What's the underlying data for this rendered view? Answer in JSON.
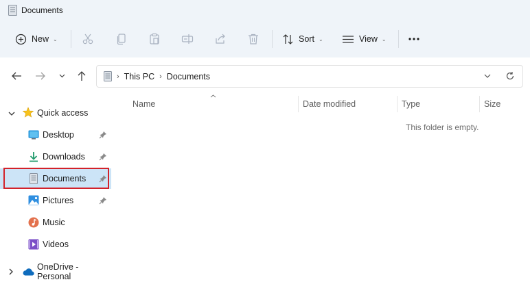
{
  "window": {
    "title": "Documents"
  },
  "toolbar": {
    "new_label": "New",
    "sort_label": "Sort",
    "view_label": "View",
    "icons": [
      "plus-circle-icon",
      "cut-icon",
      "copy-icon",
      "paste-icon",
      "rename-icon",
      "share-icon",
      "delete-icon",
      "sort-icon",
      "view-icon",
      "more-icon"
    ]
  },
  "address": {
    "crumbs": [
      "This PC",
      "Documents"
    ]
  },
  "sidebar": {
    "quick_access": "Quick access",
    "items": [
      {
        "label": "Desktop",
        "icon": "desktop-icon",
        "pinned": true
      },
      {
        "label": "Downloads",
        "icon": "downloads-icon",
        "pinned": true
      },
      {
        "label": "Documents",
        "icon": "documents-icon",
        "pinned": true,
        "selected": true
      },
      {
        "label": "Pictures",
        "icon": "pictures-icon",
        "pinned": true
      },
      {
        "label": "Music",
        "icon": "music-icon",
        "pinned": false
      },
      {
        "label": "Videos",
        "icon": "videos-icon",
        "pinned": false
      }
    ],
    "onedrive": "OneDrive - Personal"
  },
  "columns": {
    "name": "Name",
    "date_modified": "Date modified",
    "type": "Type",
    "size": "Size"
  },
  "content": {
    "empty_message": "This folder is empty."
  },
  "colors": {
    "accent": "#0067c0",
    "selection": "#cce4f7",
    "highlight": "#d3222a",
    "chrome": "#eff4f9"
  }
}
